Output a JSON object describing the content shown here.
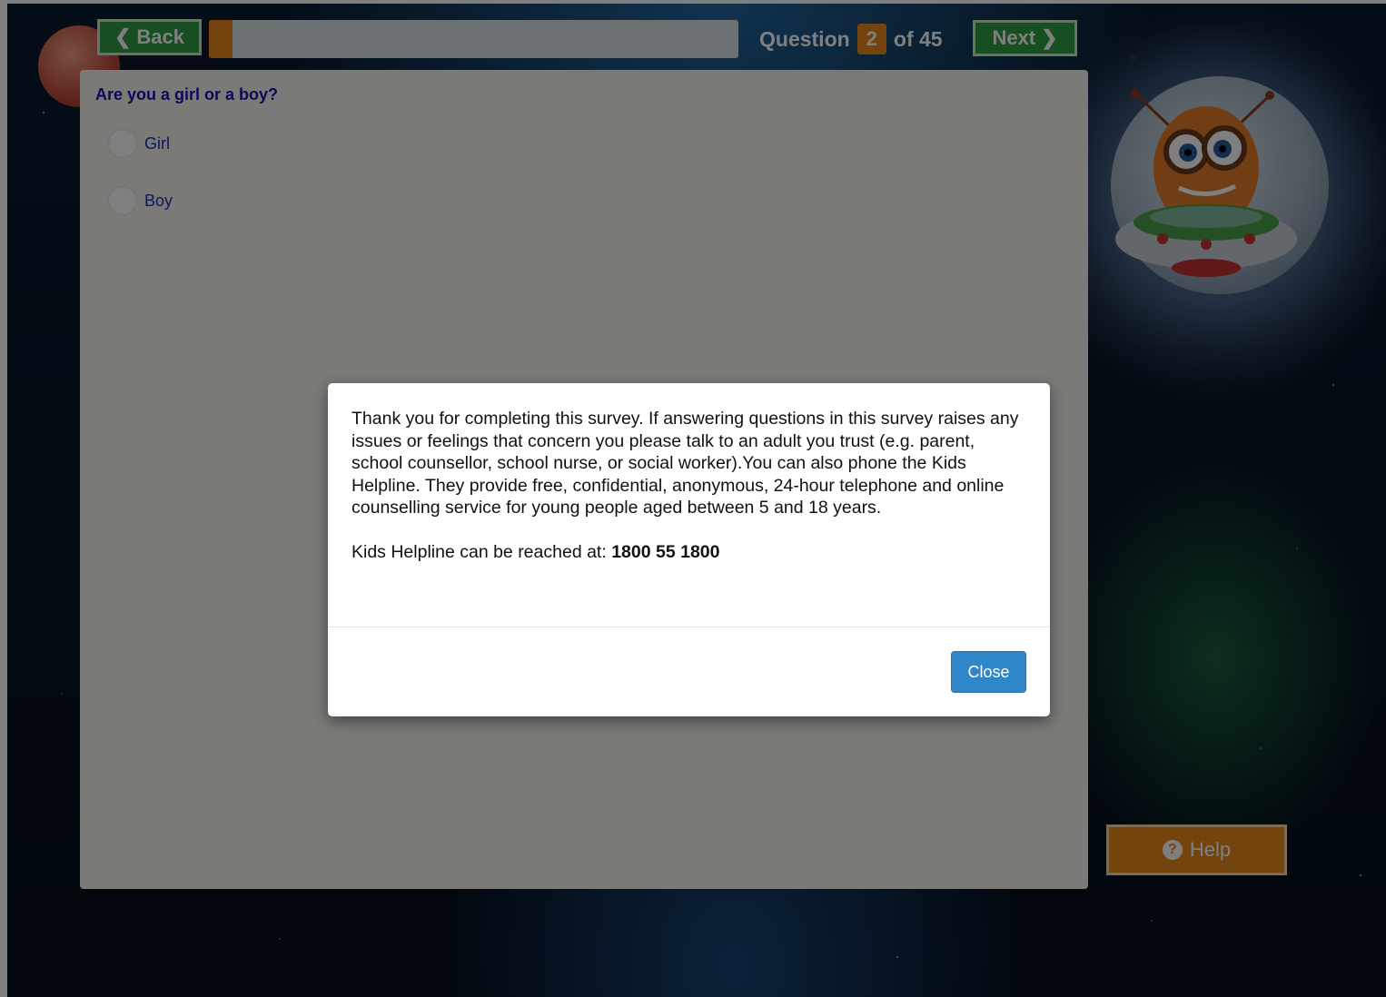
{
  "nav": {
    "back_label": "Back",
    "next_label": "Next",
    "question_prefix": "Question",
    "question_current": "2",
    "question_suffix": "of 45",
    "progress_fraction": 0.044
  },
  "question": {
    "title": "Are you a girl or a boy?",
    "options": [
      {
        "label": "Girl"
      },
      {
        "label": "Boy"
      }
    ]
  },
  "help": {
    "label": "Help"
  },
  "modal": {
    "message": "Thank you for completing this survey. If answering questions in this survey raises any issues or feelings that concern you please talk to an adult you trust (e.g. parent, school counsellor, school nurse, or social worker).You can also phone the Kids Helpline. They provide free, confidential, anonymous, 24-hour telephone and online counselling service for young people aged between 5 and 18 years.",
    "helpline_prefix": "Kids Helpline can be reached at:",
    "helpline_number": "1800 55 1800",
    "close_label": "Close"
  },
  "colors": {
    "nav_green": "#2f9d45",
    "accent_orange": "#e8891f",
    "question_blue": "#1212b8",
    "close_blue": "#2f86c8"
  }
}
